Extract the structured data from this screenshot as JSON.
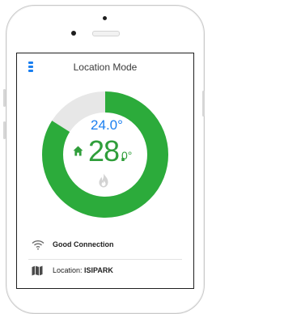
{
  "header": {
    "title": "Location Mode"
  },
  "thermostat": {
    "setpoint_int": "24.0",
    "setpoint_unit": "°",
    "current_int": "28.",
    "current_dec": "0°",
    "ring_fill_fraction": 0.84,
    "colors": {
      "ring_active": "#2cab3b",
      "ring_track": "#e7e7e7",
      "setpoint": "#1a7ff0",
      "current": "#2f9e3a"
    }
  },
  "status": {
    "connection_label": "Good Connection",
    "location_prefix": "Location: ",
    "location_name": "ISIPARK"
  },
  "icons": [
    "menu-icon",
    "home-icon",
    "flame-icon",
    "wifi-icon",
    "map-icon"
  ]
}
